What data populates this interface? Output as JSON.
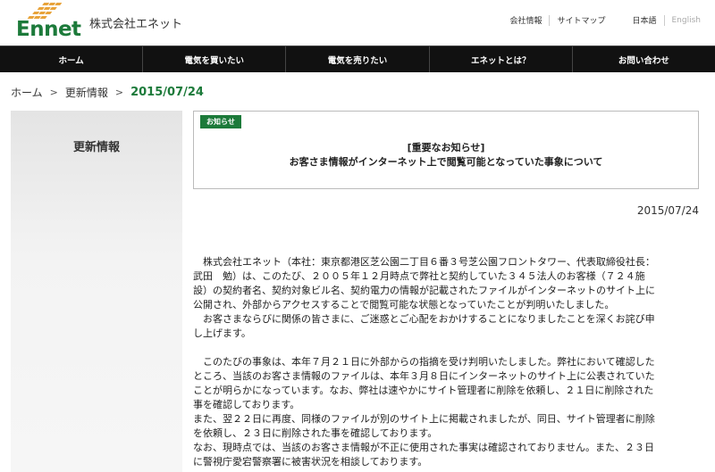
{
  "header": {
    "logo_text": "Ennet",
    "company_name": "株式会社エネット",
    "util_links": [
      "会社情報",
      "サイトマップ",
      "日本語",
      "English"
    ]
  },
  "nav": {
    "items": [
      "ホーム",
      "電気を買いたい",
      "電気を売りたい",
      "エネットとは？",
      "お問い合わせ"
    ]
  },
  "breadcrumb": {
    "items": [
      "ホーム",
      "更新情報",
      "2015/07/24"
    ],
    "separator": ">"
  },
  "sidebar": {
    "title": "更新情報"
  },
  "notice": {
    "badge": "お知らせ",
    "line1": "[重要なお知らせ]",
    "line2": "お客さま情報がインターネット上で閲覧可能となっていた事象について"
  },
  "date": "2015/07/24",
  "body": {
    "lines": [
      "　株式会社エネット（本社：東京都港区芝公園二丁目６番３号芝公園フロントタワー、代表取締役社長：",
      "武田　勉）は、このたび、２００５年１２月時点で弊社と契約していた３４５法人のお客様（７２４施",
      "設）の契約者名、契約対象ビル名、契約電力の情報が記載されたファイルがインターネットのサイト上に",
      "公開され、外部からアクセスすることで閲覧可能な状態となっていたことが判明いたしました。",
      "　お客さまならびに関係の皆さまに、ご迷惑とご心配をおかけすることになりましたことを深くお詫び申",
      "し上げます。",
      "",
      "　このたびの事象は、本年７月２１日に外部からの指摘を受け判明いたしました。弊社において確認した",
      "ところ、当該のお客さま情報のファイルは、本年３月８日にインターネットのサイト上に公表されていた",
      "ことが明らかになっています。なお、弊社は速やかにサイト管理者に削除を依頼し、２１日に削除された",
      "事を確認しております。",
      "また、翌２２日に再度、同様のファイルが別のサイト上に掲載されましたが、同日、サイト管理者に削除",
      "を依頼し、２３日に削除された事を確認しております。",
      "なお、現時点では、当該のお客さま情報が不正に使用された事実は確認されておりません。また、２３日",
      "に警視庁愛宕警察署に被害状況を相談しております。"
    ]
  },
  "colors": {
    "brand_green": "#1c7a3a",
    "logo_orange": "#e8a33a",
    "nav_bg": "#111111"
  }
}
